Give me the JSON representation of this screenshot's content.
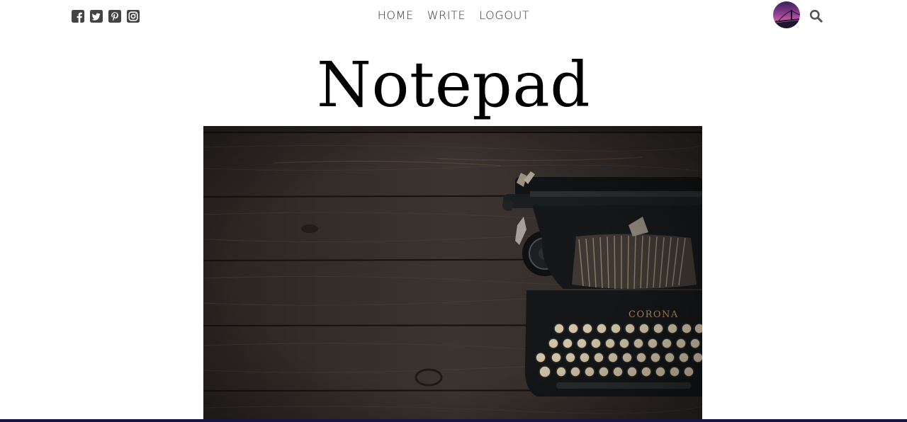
{
  "header": {
    "social_icons": [
      "facebook-square-icon",
      "twitter-square-icon",
      "pinterest-square-icon",
      "instagram-icon"
    ],
    "nav": {
      "home": "HOME",
      "write": "WRITE",
      "logout": "LOGOUT"
    },
    "avatar_icon": "user-avatar",
    "search_icon": "search-icon"
  },
  "page": {
    "title": "Notepad"
  },
  "hero": {
    "image": "typewriter-on-wooden-table",
    "typewriter_brand": "CORONA"
  },
  "colors": {
    "text": "#333333",
    "icon": "#444444",
    "footer_bar": "#1a1544",
    "wood": "#3a332f"
  }
}
